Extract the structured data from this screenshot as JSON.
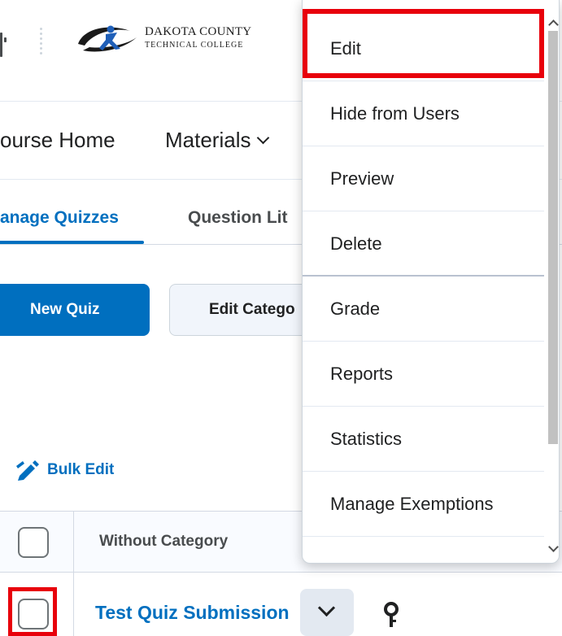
{
  "header": {
    "logo": {
      "name_line1": "DAKOTA COUNTY",
      "name_line2": "TECHNICAL COLLEGE",
      "colors": {
        "swoosh": "#1a1a1a",
        "figure": "#1f5fb8"
      }
    }
  },
  "nav": {
    "items": [
      {
        "label": "ourse Home"
      },
      {
        "label": "Materials",
        "has_dropdown": true
      }
    ]
  },
  "tabs": [
    {
      "label": "anage Quizzes",
      "active": true
    },
    {
      "label": "Question Lit",
      "active": false
    }
  ],
  "toolbar": {
    "new_quiz_label": "New Quiz",
    "edit_categories_label": "Edit Catego"
  },
  "bulk_edit": {
    "label": "Bulk Edit",
    "icon": "pencil-icon"
  },
  "table": {
    "header": {
      "category_label": "Without Category"
    },
    "rows": [
      {
        "quiz_name": "Test Quiz Submission",
        "context_icon": "chevron-down-icon",
        "status_icon": "key-icon"
      }
    ]
  },
  "context_menu": {
    "items": [
      {
        "label": "Edit",
        "highlighted": true
      },
      {
        "label": "Hide from Users"
      },
      {
        "label": "Preview"
      },
      {
        "label": "Delete"
      },
      {
        "label": "Grade"
      },
      {
        "label": "Reports"
      },
      {
        "label": "Statistics"
      },
      {
        "label": "Manage Exemptions"
      }
    ]
  },
  "annotation_colors": {
    "highlight": "#e8000b",
    "accent": "#006fbf"
  }
}
